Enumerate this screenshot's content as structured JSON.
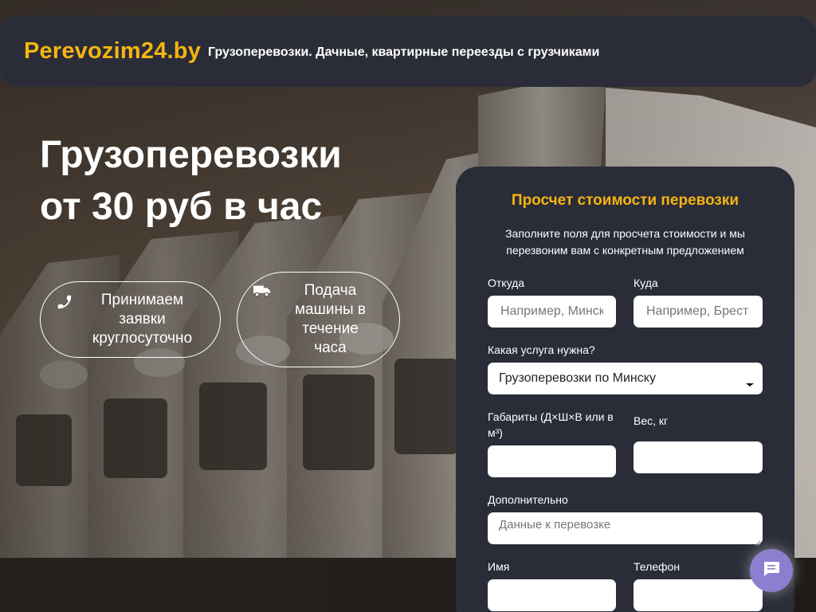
{
  "header": {
    "logo": "Perevozim24.by",
    "tagline": "Грузоперевозки. Дачные, квартирные переезды с грузчиками"
  },
  "hero": {
    "title_line1": "Грузоперевозки",
    "title_line2": "от 30 руб в час"
  },
  "features": [
    {
      "icon": "phone-icon",
      "text": "Принимаем заявки круглосуточно"
    },
    {
      "icon": "truck-icon",
      "text": "Подача машины в течение часа"
    }
  ],
  "form": {
    "title": "Просчет стоимости перевозки",
    "subtitle": "Заполните поля для просчета стоимости и мы перезвоним вам с конкретным предложением",
    "from_label": "Откуда",
    "from_placeholder": "Например, Минск",
    "to_label": "Куда",
    "to_placeholder": "Например, Брест",
    "service_label": "Какая услуга нужна?",
    "service_value": "Грузоперевозки по Минску",
    "dimensions_label": "Габариты (Д×Ш×В или в м³)",
    "weight_label": "Вес, кг",
    "extra_label": "Дополнительно",
    "extra_placeholder": "Данные к перевозке",
    "name_label": "Имя",
    "phone_label": "Телефон"
  },
  "colors": {
    "accent": "#f5b412",
    "panel": "#2a2d38",
    "chat": "#8e7ecf"
  },
  "chat": {
    "icon": "chat-icon"
  }
}
